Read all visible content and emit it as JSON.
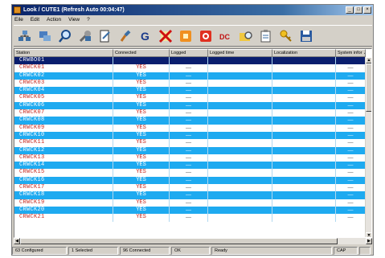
{
  "window": {
    "title": "Look / CUTE1 (Refresh Auto 00:04:47)",
    "controls": [
      "_",
      "□",
      "×"
    ]
  },
  "menu": [
    "Eile",
    "Edit",
    "Action",
    "View",
    "?"
  ],
  "toolbar": {
    "buttons": [
      {
        "icon": "network-stations-icon"
      },
      {
        "icon": "connect-icon"
      },
      {
        "icon": "search-icon"
      },
      {
        "icon": "tools-icon"
      },
      {
        "icon": "document-edit-icon"
      },
      {
        "icon": "brush-icon"
      },
      {
        "icon": "refresh-g-icon"
      },
      {
        "icon": "delete-x-icon"
      },
      {
        "icon": "orange-square-icon"
      },
      {
        "icon": "red-stop-icon"
      },
      {
        "icon": "dc-icon"
      },
      {
        "icon": "folder-search-icon"
      },
      {
        "icon": "clipboard-icon"
      },
      {
        "icon": "key-icon"
      },
      {
        "icon": "save-disk-icon"
      }
    ]
  },
  "grid": {
    "columns": [
      "Station",
      "Connected",
      "Logged",
      "Logged time",
      "Localization",
      "System infor"
    ],
    "sort_indicator": "▲",
    "rows": [
      {
        "station": "CRWBO01",
        "connected": "",
        "logged": "",
        "style": "sel"
      },
      {
        "station": "CRWCK01",
        "connected": "YES",
        "logged": "—",
        "style": "white"
      },
      {
        "station": "CRWCK02",
        "connected": "YES",
        "logged": "—",
        "style": "alt"
      },
      {
        "station": "CRWCK03",
        "connected": "YES",
        "logged": "—",
        "style": "white"
      },
      {
        "station": "CRWCK04",
        "connected": "YES",
        "logged": "—",
        "style": "alt"
      },
      {
        "station": "CRWCK05",
        "connected": "YES",
        "logged": "—",
        "style": "white"
      },
      {
        "station": "CRWCK06",
        "connected": "YES",
        "logged": "—",
        "style": "alt"
      },
      {
        "station": "CRWCK07",
        "connected": "YES",
        "logged": "—",
        "style": "white"
      },
      {
        "station": "CRWCK08",
        "connected": "YES",
        "logged": "—",
        "style": "alt"
      },
      {
        "station": "CRWCK09",
        "connected": "YES",
        "logged": "—",
        "style": "white"
      },
      {
        "station": "CRWCK10",
        "connected": "YES",
        "logged": "—",
        "style": "alt"
      },
      {
        "station": "CRWCK11",
        "connected": "YES",
        "logged": "—",
        "style": "white"
      },
      {
        "station": "CRWCK12",
        "connected": "YES",
        "logged": "—",
        "style": "alt"
      },
      {
        "station": "CRWCK13",
        "connected": "YES",
        "logged": "—",
        "style": "white"
      },
      {
        "station": "CRWCK14",
        "connected": "YES",
        "logged": "—",
        "style": "alt"
      },
      {
        "station": "CRWCK15",
        "connected": "YES",
        "logged": "—",
        "style": "white"
      },
      {
        "station": "CRWCK16",
        "connected": "YES",
        "logged": "—",
        "style": "alt"
      },
      {
        "station": "CRWCK17",
        "connected": "YES",
        "logged": "—",
        "style": "white"
      },
      {
        "station": "CRWCK18",
        "connected": "YES",
        "logged": "—",
        "style": "alt"
      },
      {
        "station": "CRWCK19",
        "connected": "YES",
        "logged": "—",
        "style": "white"
      },
      {
        "station": "CRWCK20",
        "connected": "YES",
        "logged": "—",
        "style": "alt"
      },
      {
        "station": "CRWCK21",
        "connected": "YES",
        "logged": "—",
        "style": "white"
      }
    ]
  },
  "status": {
    "configured": "63 Configured",
    "selected": "1 Selected",
    "connected": "96 Connected",
    "ok": "OK",
    "ready": "Ready",
    "cap": "CAP"
  },
  "colors": {
    "alt_row": "#1eaaf0",
    "selected_row": "#0a1e6e",
    "station_text": "#c8281e",
    "title_bar": "#0a246a"
  }
}
